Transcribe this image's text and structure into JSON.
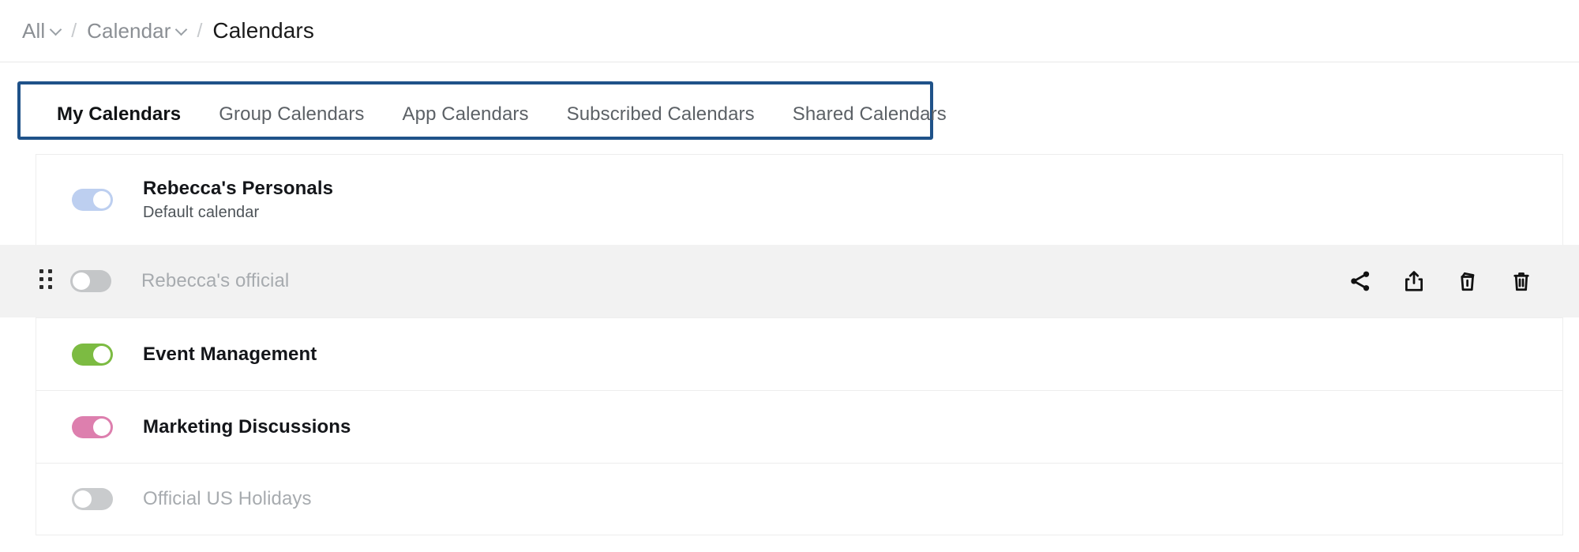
{
  "breadcrumb": {
    "items": [
      {
        "label": "All",
        "has_chevron": true,
        "current": false
      },
      {
        "label": "Calendar",
        "has_chevron": true,
        "current": false
      },
      {
        "label": "Calendars",
        "has_chevron": false,
        "current": true
      }
    ],
    "separator": "/"
  },
  "tabs": {
    "highlight_color": "#1f5289",
    "items": [
      {
        "label": "My Calendars",
        "active": true
      },
      {
        "label": "Group Calendars",
        "active": false
      },
      {
        "label": "App Calendars",
        "active": false
      },
      {
        "label": "Subscribed Calendars",
        "active": false
      },
      {
        "label": "Shared Calendars",
        "active": false
      }
    ]
  },
  "calendars": [
    {
      "name": "Rebecca's Personals",
      "subtitle": "Default calendar",
      "toggle_state": "on",
      "toggle_color": "#bdcff0",
      "muted": false,
      "highlighted": false,
      "has_drag_handle": false,
      "show_actions": false
    },
    {
      "name": "Rebecca's official",
      "subtitle": "",
      "toggle_state": "off",
      "toggle_color": "#c4c6c8",
      "muted": true,
      "highlighted": true,
      "has_drag_handle": true,
      "show_actions": true
    },
    {
      "name": "Event Management",
      "subtitle": "",
      "toggle_state": "on",
      "toggle_color": "#7cbb42",
      "muted": false,
      "highlighted": false,
      "has_drag_handle": false,
      "show_actions": false
    },
    {
      "name": "Marketing Discussions",
      "subtitle": "",
      "toggle_state": "on",
      "toggle_color": "#dd7fae",
      "muted": false,
      "highlighted": false,
      "has_drag_handle": false,
      "show_actions": false
    },
    {
      "name": "Official US Holidays",
      "subtitle": "",
      "toggle_state": "off",
      "toggle_color": "#c9cbcd",
      "muted": true,
      "highlighted": false,
      "has_drag_handle": false,
      "show_actions": false
    }
  ],
  "row_actions": [
    {
      "icon": "share-icon",
      "label": "Share"
    },
    {
      "icon": "export-icon",
      "label": "Export"
    },
    {
      "icon": "trash-open-lid-icon",
      "label": "Delete events"
    },
    {
      "icon": "trash-icon",
      "label": "Delete calendar"
    }
  ]
}
